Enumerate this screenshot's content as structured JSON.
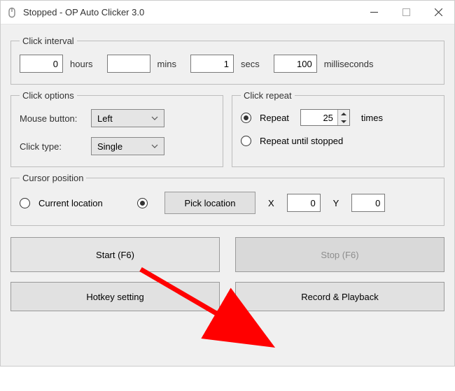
{
  "window": {
    "title": "Stopped - OP Auto Clicker 3.0"
  },
  "click_interval": {
    "legend": "Click interval",
    "hours_value": "0",
    "hours_unit": "hours",
    "mins_value": "",
    "mins_unit": "mins",
    "secs_value": "1",
    "secs_unit": "secs",
    "ms_value": "100",
    "ms_unit": "milliseconds"
  },
  "click_options": {
    "legend": "Click options",
    "mouse_button_label": "Mouse button:",
    "mouse_button_value": "Left",
    "click_type_label": "Click type:",
    "click_type_value": "Single"
  },
  "click_repeat": {
    "legend": "Click repeat",
    "repeat_label": "Repeat",
    "repeat_value": "25",
    "repeat_unit": "times",
    "until_stopped_label": "Repeat until stopped"
  },
  "cursor_position": {
    "legend": "Cursor position",
    "current_location_label": "Current location",
    "pick_location_label": "Pick location",
    "x_label": "X",
    "x_value": "0",
    "y_label": "Y",
    "y_value": "0"
  },
  "buttons": {
    "start": "Start (F6)",
    "stop": "Stop (F6)",
    "hotkey": "Hotkey setting",
    "record": "Record & Playback"
  }
}
